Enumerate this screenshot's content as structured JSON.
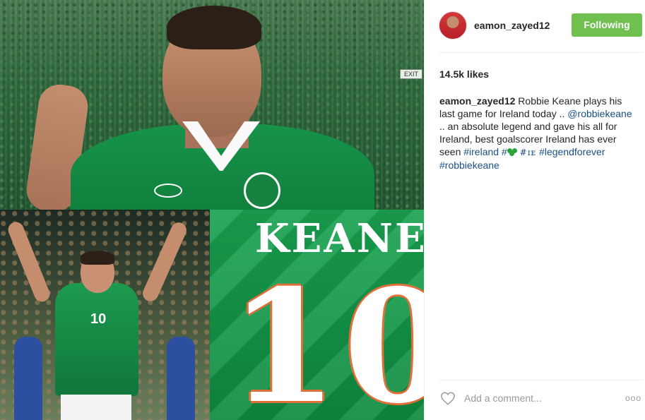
{
  "post": {
    "photo_alt": "",
    "shirt": {
      "name": "KEANE",
      "number": "10",
      "small_number": "10"
    },
    "exit_sign": "EXIT"
  },
  "header": {
    "username": "eamon_zayed12",
    "follow_label": "Following",
    "follow_color": "#70c050"
  },
  "likes": "14.5k likes",
  "caption": {
    "user": "eamon_zayed12",
    "text1": " Robbie Keane plays his last game for Ireland today .. ",
    "mention": "@robbiekeane",
    "text2": " .. an absolute legend and gave his all for Ireland, best goalscorer Ireland has ever seen ",
    "tag_ireland": "#ireland",
    "tag_hash": "#",
    "tag_ie": "#ɪᴇ",
    "tag_legend": "#legendforever",
    "tag_robbie": "#robbiekeane"
  },
  "footer": {
    "comment_placeholder": "Add a comment...",
    "more_label": "ooo",
    "heart_icon": "heart-icon"
  },
  "colors": {
    "hashtag": "#1b4f86",
    "accent_green": "#70c050"
  }
}
